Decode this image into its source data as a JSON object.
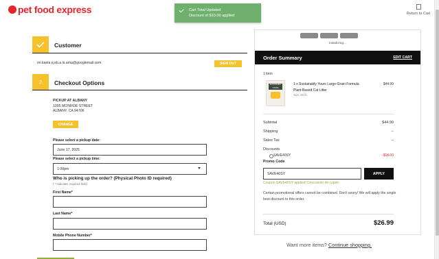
{
  "header": {
    "logo_text": "pet food express",
    "ghost_text": "Pr",
    "return_label": "Return to Cart"
  },
  "toast": {
    "title": "Cart Total Updated",
    "message": "Discount of $10.00 applied"
  },
  "customer": {
    "step_label": "Customer",
    "email": "mi.kaela.q.eb.a.ls.ama@googlemail.com",
    "sign_out_label": "SIGN OUT"
  },
  "checkout": {
    "step_number": "2",
    "step_label": "Checkout Options",
    "store_name": "PICKUP AT ALBANY",
    "store_street": "1095 MONROE STREET",
    "store_city": "ALBANY, CA 94706",
    "change_label": "CHANGE",
    "pickup_date_label": "Please select a pickup date:",
    "pickup_date_value": "June 17, 2025",
    "pickup_time_label": "Please select a pickup time:",
    "pickup_time_value": "1:00pm",
    "who_heading": "Who is picking up the order? (Physical Photo ID required)",
    "required_note": "( * indicates required field)",
    "first_name_label": "First Name*",
    "last_name_label": "Last Name*",
    "phone_label": "Mobile Phone Number*"
  },
  "summary": {
    "initializing": "Initializing...",
    "title": "Order Summary",
    "edit_cart": "EDIT CART",
    "item_count": "1 item",
    "item_name_line1": "1 x Sustainably Yours Large-Grain Formula",
    "item_name_line2": "Plant-Based Cat Litter",
    "item_size": "Size 26 lb",
    "item_price": "$44.99",
    "item_image_label": "SUSTAINABLY YOURS",
    "subtotal_label": "Subtotal",
    "subtotal_value": "$44.99",
    "shipping_label": "Shipping",
    "shipping_value": "--",
    "tax_label": "Sales Tax",
    "tax_value": "--",
    "discounts_label": "Discounts",
    "discount_code_row": "SAVE40SY",
    "discount_value": "-$18.00",
    "promo_label": "Promo Code",
    "promo_value": "SAVE40SY",
    "apply_label": "APPLY",
    "promo_success": "Coupon SAVE40SY applied! Descuento de cupón",
    "promo_note": "Certain promotional offers cannot be combined. Don't worry! We will apply the single best discount to this order.",
    "total_label": "Total (USD)",
    "total_value": "$26.99",
    "want_more": "Want more items?",
    "continue_link": "Continue shopping."
  },
  "colors": {
    "brand_red": "#e4262c",
    "accent_yellow": "#f5c22b",
    "toast_green": "#6fb06d",
    "discount_red": "#d21f2a",
    "success_green": "#8fb13a"
  }
}
